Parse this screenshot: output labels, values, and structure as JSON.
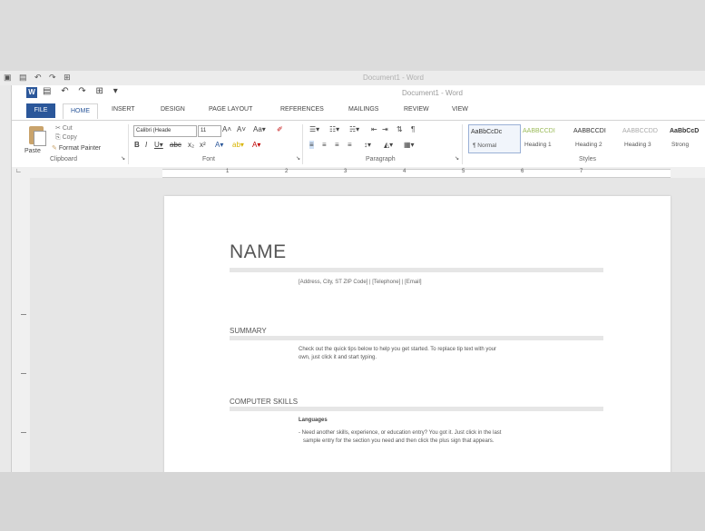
{
  "back_window": {
    "title": "Document1 - Word"
  },
  "window": {
    "title": "Document1 - Word",
    "logo": "W",
    "qat_icons": [
      "save-icon",
      "undo-icon",
      "redo-icon",
      "touch-mode-icon"
    ]
  },
  "tabs": [
    "FILE",
    "HOME",
    "INSERT",
    "DESIGN",
    "PAGE LAYOUT",
    "REFERENCES",
    "MAILINGS",
    "REVIEW",
    "VIEW"
  ],
  "clipboard": {
    "paste": "Paste",
    "cut": "Cut",
    "copy": "Copy",
    "format_painter": "Format Painter",
    "label": "Clipboard"
  },
  "font": {
    "name": "Calibri (Heade",
    "size": "11",
    "label": "Font"
  },
  "paragraph": {
    "label": "Paragraph"
  },
  "styles": {
    "label": "Styles",
    "items": [
      {
        "sample": "AaBbCcDc",
        "name": "¶ Normal",
        "color": "#333333"
      },
      {
        "sample": "AABBCCDI",
        "name": "Heading 1",
        "color": "#9bbb59"
      },
      {
        "sample": "AABBCCDI",
        "name": "Heading 2",
        "color": "#333333"
      },
      {
        "sample": "AABBCCDD",
        "name": "Heading 3",
        "color": "#aaaaaa"
      },
      {
        "sample": "AaBbCcD",
        "name": "Strong",
        "color": "#333333"
      }
    ]
  },
  "ruler": {
    "numbers": [
      "1",
      "2",
      "3",
      "4",
      "5",
      "6",
      "7"
    ]
  },
  "document": {
    "name_heading": "NAME",
    "contact": "[Address, City, ST ZIP Code] | [Telephone] | [Email]",
    "summary_heading": "SUMMARY",
    "summary_line1": "Check out the quick tips below to help you get started. To replace tip text with your",
    "summary_line2": "own, just click it and start typing.",
    "skills_heading": "COMPUTER SKILLS",
    "languages": "Languages",
    "skills_line1": "- Need another skills, experience, or education entry? You got it. Just click in the last",
    "skills_line2": "sample entry for the section you need and then click the plus sign that appears."
  }
}
